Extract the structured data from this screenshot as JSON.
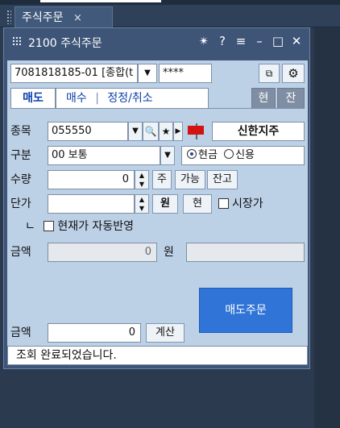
{
  "tab": {
    "label": "주식주문",
    "close": "×"
  },
  "window": {
    "title": "2100 주식주문",
    "icons": {
      "pin": "✴",
      "help": "?",
      "menu": "≡",
      "min": "–",
      "max": "□",
      "close": "✕"
    }
  },
  "account": {
    "number": "7081818185-01 [종합(t",
    "password": "****"
  },
  "tabs": {
    "sell": "매도",
    "buy": "매수",
    "modify": "정정/취소",
    "current": "현",
    "balance": "잔"
  },
  "stock": {
    "label": "종목",
    "code": "055550",
    "name": "신한지주"
  },
  "type": {
    "label": "구분",
    "value": "00 보통",
    "cash": "현금",
    "credit": "신용"
  },
  "qty": {
    "label": "수량",
    "value": "0",
    "unit": "주",
    "avail": "가능",
    "remain": "잔고"
  },
  "price": {
    "label": "단가",
    "value": "",
    "won": "원",
    "cur": "현",
    "market": "시장가"
  },
  "auto": {
    "prefix": "ㄴ",
    "label": "현재가 자동반영"
  },
  "amount1": {
    "label": "금액",
    "value": "0",
    "unit": "원"
  },
  "amount2": {
    "label": "금액",
    "value": "0",
    "calc": "계산"
  },
  "order": {
    "label": "매도주문"
  },
  "status": {
    "message": "조회 완료되었습니다."
  },
  "colors": {
    "sell_tab": "#0b3ea8",
    "stock_name": "#000000",
    "flag": "#d31212"
  }
}
